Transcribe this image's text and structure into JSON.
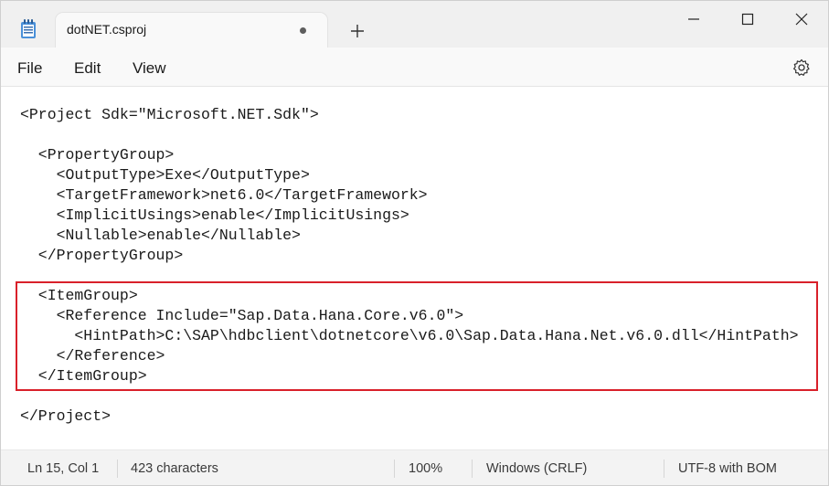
{
  "tab": {
    "title": "dotNET.csproj"
  },
  "menu": {
    "file": "File",
    "edit": "Edit",
    "view": "View"
  },
  "editor": {
    "lines": [
      "<Project Sdk=\"Microsoft.NET.Sdk\">",
      "",
      "  <PropertyGroup>",
      "    <OutputType>Exe</OutputType>",
      "    <TargetFramework>net6.0</TargetFramework>",
      "    <ImplicitUsings>enable</ImplicitUsings>",
      "    <Nullable>enable</Nullable>",
      "  </PropertyGroup>",
      "",
      "  <ItemGroup>",
      "    <Reference Include=\"Sap.Data.Hana.Core.v6.0\">",
      "      <HintPath>C:\\SAP\\hdbclient\\dotnetcore\\v6.0\\Sap.Data.Hana.Net.v6.0.dll</HintPath>",
      "    </Reference>",
      "  </ItemGroup>",
      "",
      "</Project>"
    ]
  },
  "status": {
    "position": "Ln 15, Col 1",
    "characters": "423 characters",
    "zoom": "100%",
    "line_ending": "Windows (CRLF)",
    "encoding": "UTF-8 with BOM"
  },
  "colors": {
    "highlight_border": "#d9202a"
  }
}
